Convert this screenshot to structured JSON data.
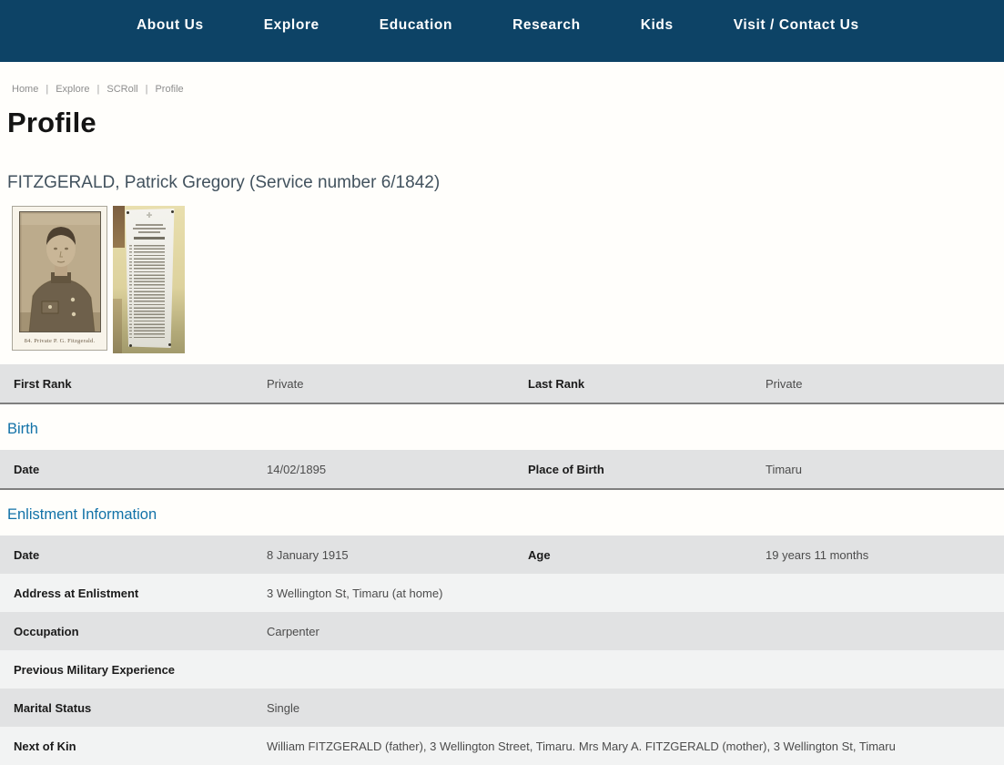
{
  "nav": {
    "items": [
      {
        "label": "About Us"
      },
      {
        "label": "Explore"
      },
      {
        "label": "Education"
      },
      {
        "label": "Research"
      },
      {
        "label": "Kids"
      },
      {
        "label": "Visit / Contact Us"
      }
    ]
  },
  "breadcrumb": {
    "separator": "|",
    "items": [
      {
        "label": "Home"
      },
      {
        "label": "Explore"
      },
      {
        "label": "SCRoll"
      },
      {
        "label": "Profile"
      }
    ]
  },
  "page": {
    "title": "Profile",
    "subtitle": "FITZGERALD, Patrick Gregory (Service number 6/1842)"
  },
  "images": {
    "portrait": {
      "caption": "84. Private P. G. Fitzgerald."
    },
    "plaque": {
      "name": "roll-of-honour-memorial-photo"
    }
  },
  "tables": {
    "rank": {
      "rows": [
        {
          "label1": "First Rank",
          "value1": "Private",
          "label2": "Last Rank",
          "value2": "Private"
        }
      ]
    },
    "birth": {
      "heading": "Birth",
      "rows": [
        {
          "label1": "Date",
          "value1": "14/02/1895",
          "label2": "Place of Birth",
          "value2": "Timaru"
        }
      ]
    },
    "enlistment": {
      "heading": "Enlistment Information",
      "rows": [
        {
          "label1": "Date",
          "value1": "8 January 1915",
          "label2": "Age",
          "value2": "19 years 11 months"
        },
        {
          "label1": "Address at Enlistment",
          "value1": "3 Wellington St, Timaru (at home)"
        },
        {
          "label1": "Occupation",
          "value1": "Carpenter"
        },
        {
          "label1": "Previous Military Experience",
          "value1": ""
        },
        {
          "label1": "Marital Status",
          "value1": "Single"
        },
        {
          "label1": "Next of Kin",
          "value1": "William FITZGERALD (father), 3 Wellington Street, Timaru. Mrs Mary A. FITZGERALD (mother), 3 Wellington St, Timaru"
        }
      ]
    }
  },
  "colors": {
    "nav_background": "#0d4366",
    "nav_text": "#ffffff",
    "section_heading_blue": "#1272a8",
    "row_gray": "#e1e2e3",
    "row_light": "#f2f3f3",
    "table_border": "#7f7f7f",
    "breadcrumb_text": "#8e8e8e"
  }
}
